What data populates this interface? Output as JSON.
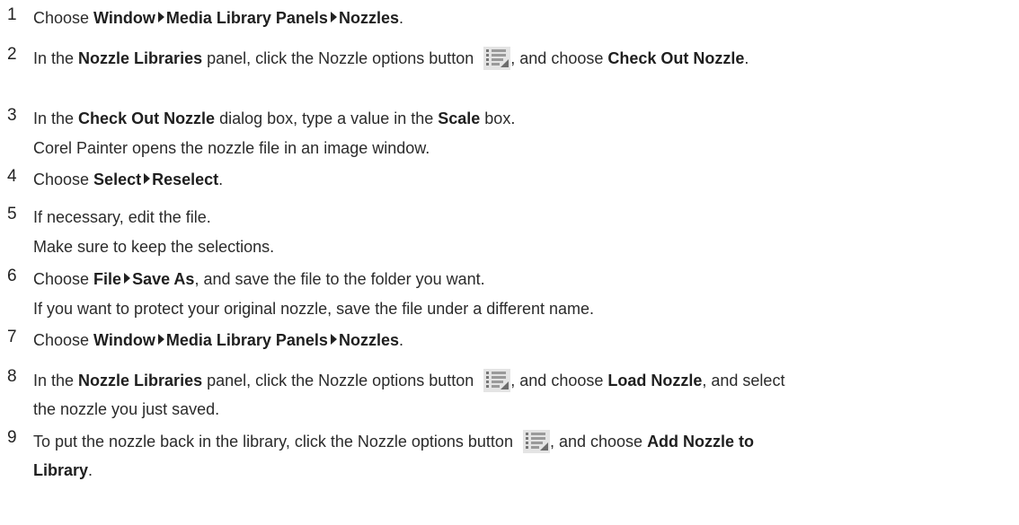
{
  "steps": [
    {
      "number": "1",
      "lines": [
        [
          {
            "t": "text",
            "v": "Choose "
          },
          {
            "t": "bold",
            "v": "Window"
          },
          {
            "t": "arrow"
          },
          {
            "t": "bold",
            "v": "Media Library Panels"
          },
          {
            "t": "arrow"
          },
          {
            "t": "bold",
            "v": "Nozzles"
          },
          {
            "t": "text",
            "v": "."
          }
        ]
      ]
    },
    {
      "number": "2",
      "lines": [
        [
          {
            "t": "text",
            "v": "In the "
          },
          {
            "t": "bold",
            "v": "Nozzle Libraries"
          },
          {
            "t": "text",
            "v": " panel, click the Nozzle options button "
          },
          {
            "t": "icon",
            "v": "nozzle-options-icon"
          },
          {
            "t": "text",
            "v": ", and choose "
          },
          {
            "t": "bold",
            "v": "Check Out Nozzle"
          },
          {
            "t": "text",
            "v": "."
          }
        ]
      ]
    },
    {
      "number": "3",
      "lines": [
        [
          {
            "t": "text",
            "v": "In the "
          },
          {
            "t": "bold",
            "v": "Check Out Nozzle"
          },
          {
            "t": "text",
            "v": " dialog box, type a value in the "
          },
          {
            "t": "bold",
            "v": "Scale"
          },
          {
            "t": "text",
            "v": " box."
          }
        ],
        [
          {
            "t": "text",
            "v": "Corel Painter opens the nozzle file in an image window."
          }
        ]
      ]
    },
    {
      "number": "4",
      "lines": [
        [
          {
            "t": "text",
            "v": "Choose "
          },
          {
            "t": "bold",
            "v": "Select"
          },
          {
            "t": "arrow"
          },
          {
            "t": "bold",
            "v": "Reselect"
          },
          {
            "t": "text",
            "v": "."
          }
        ]
      ]
    },
    {
      "number": "5",
      "lines": [
        [
          {
            "t": "text",
            "v": "If necessary, edit the file."
          }
        ],
        [
          {
            "t": "text",
            "v": "Make sure to keep the selections."
          }
        ]
      ]
    },
    {
      "number": "6",
      "lines": [
        [
          {
            "t": "text",
            "v": "Choose "
          },
          {
            "t": "bold",
            "v": "File"
          },
          {
            "t": "arrow"
          },
          {
            "t": "bold",
            "v": "Save As"
          },
          {
            "t": "text",
            "v": ", and save the file to the folder you want."
          }
        ],
        [
          {
            "t": "text",
            "v": "If you want to protect your original nozzle, save the file under a different name."
          }
        ]
      ]
    },
    {
      "number": "7",
      "lines": [
        [
          {
            "t": "text",
            "v": "Choose "
          },
          {
            "t": "bold",
            "v": "Window"
          },
          {
            "t": "arrow"
          },
          {
            "t": "bold",
            "v": "Media Library Panels"
          },
          {
            "t": "arrow"
          },
          {
            "t": "bold",
            "v": "Nozzles"
          },
          {
            "t": "text",
            "v": "."
          }
        ]
      ]
    },
    {
      "number": "8",
      "lines": [
        [
          {
            "t": "text",
            "v": "In the "
          },
          {
            "t": "bold",
            "v": "Nozzle Libraries"
          },
          {
            "t": "text",
            "v": " panel, click the Nozzle options button "
          },
          {
            "t": "icon",
            "v": "nozzle-options-icon"
          },
          {
            "t": "text",
            "v": ", and choose "
          },
          {
            "t": "bold",
            "v": "Load Nozzle"
          },
          {
            "t": "text",
            "v": ", and select"
          }
        ],
        [
          {
            "t": "text",
            "v": "the nozzle you just saved."
          }
        ]
      ]
    },
    {
      "number": "9",
      "lines": [
        [
          {
            "t": "text",
            "v": "To put the nozzle back in the library, click the Nozzle options button "
          },
          {
            "t": "icon",
            "v": "nozzle-options-icon"
          },
          {
            "t": "text",
            "v": ", and choose "
          },
          {
            "t": "bold",
            "v": "Add Nozzle to"
          }
        ],
        [
          {
            "t": "bold",
            "v": "Library"
          },
          {
            "t": "text",
            "v": "."
          }
        ]
      ]
    }
  ]
}
